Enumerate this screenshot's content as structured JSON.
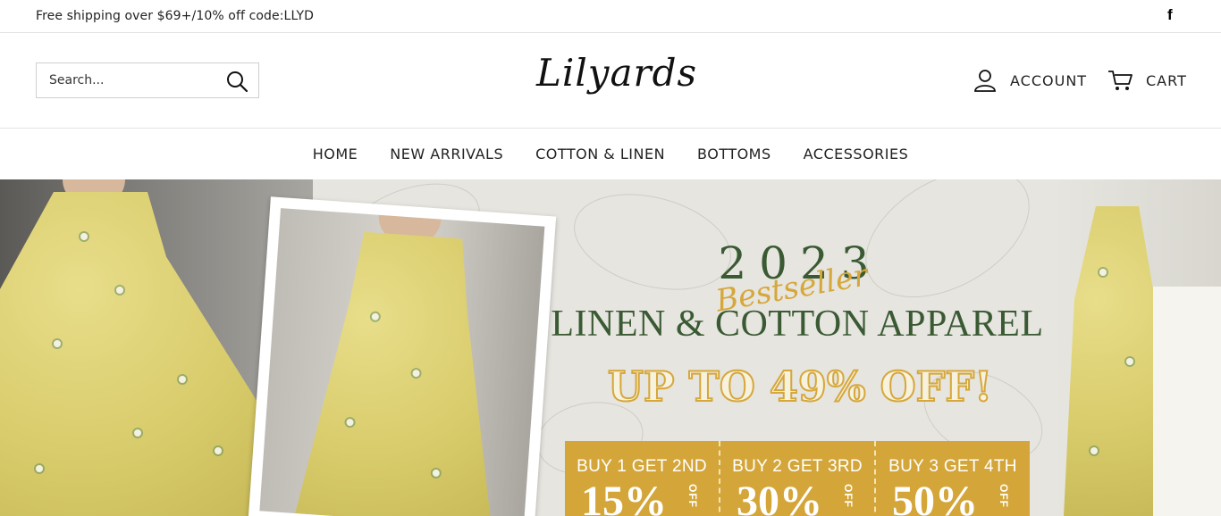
{
  "topbar": {
    "promo": "Free shipping over $69+/10% off code:LLYD",
    "social_icon": "facebook-icon",
    "social_glyph": "f"
  },
  "header": {
    "search_placeholder": "Search...",
    "logo": "Lilyards",
    "account_label": "ACCOUNT",
    "cart_label": "CART"
  },
  "nav": {
    "items": [
      "HOME",
      "NEW ARRIVALS",
      "COTTON & LINEN",
      "BOTTOMS",
      "ACCESSORIES"
    ]
  },
  "hero": {
    "year": "2023",
    "script": "Bestseller",
    "title": "LINEN & COTTON APPAREL",
    "offer": "UP TO 49% OFF!",
    "deals": [
      {
        "line1": "BUY 1 GET 2ND",
        "pct": "15%",
        "off": "OFF"
      },
      {
        "line1": "BUY 2 GET 3RD",
        "pct": "30%",
        "off": "OFF"
      },
      {
        "line1": "BUY 3 GET 4TH",
        "pct": "50%",
        "off": "OFF"
      }
    ]
  },
  "colors": {
    "accent_green": "#3a5a33",
    "accent_gold": "#d4a63a",
    "hero_bg": "#e6e5df"
  }
}
